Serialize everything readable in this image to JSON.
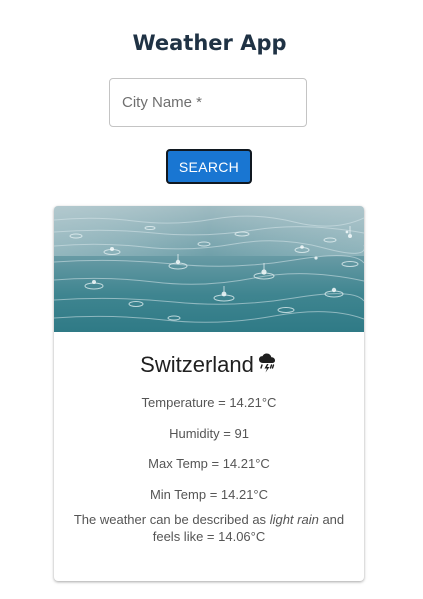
{
  "app": {
    "title": "Weather App"
  },
  "search": {
    "placeholder": "City Name *",
    "value": "",
    "button_label": "SEARCH"
  },
  "card": {
    "location": "Switzerland",
    "icon": "thunderstorm-icon",
    "temperature": "Temperature = 14.21°C",
    "humidity": "Humidity = 91",
    "max_temp": "Max Temp = 14.21°C",
    "min_temp": "Min Temp = 14.21°C",
    "description_prefix": "The weather can be described as",
    "description_condition": "light rain",
    "description_suffix": "and feels like = 14.06°C"
  },
  "colors": {
    "accent": "#1976d2",
    "title": "#1f3244",
    "water": "#4a8a95"
  }
}
